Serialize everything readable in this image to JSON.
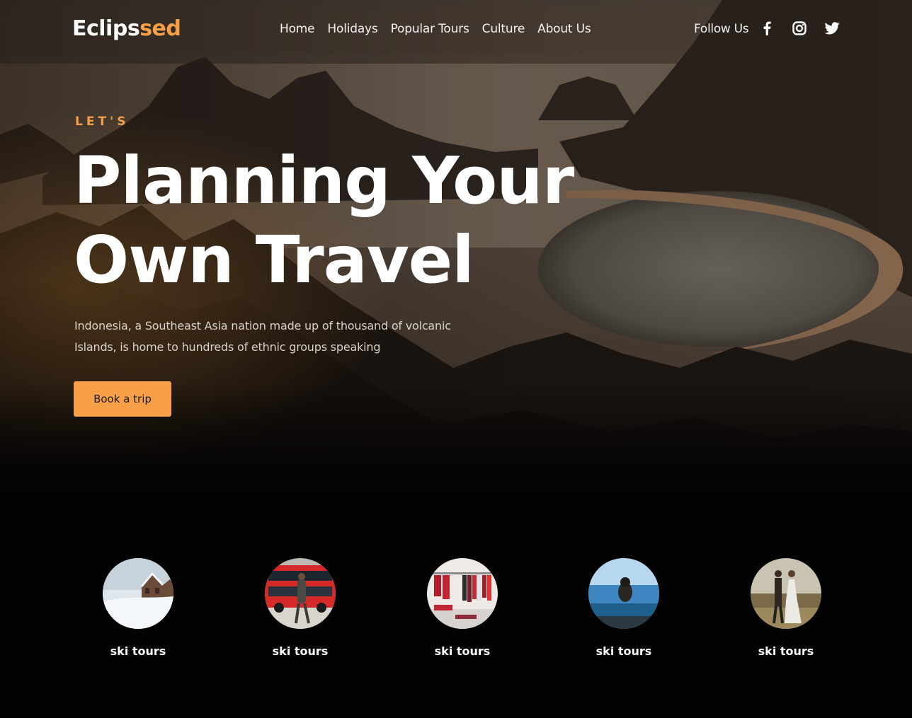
{
  "brand": {
    "part1": "Eclips",
    "part2": "sed"
  },
  "nav": [
    {
      "label": "Home"
    },
    {
      "label": "Holidays"
    },
    {
      "label": "Popular Tours"
    },
    {
      "label": "Culture"
    },
    {
      "label": "About Us"
    }
  ],
  "social": {
    "label": "Follow Us",
    "icons": [
      "facebook-icon",
      "instagram-icon",
      "twitter-icon"
    ]
  },
  "hero": {
    "eyebrow": "LET'S",
    "title_line1": "Planning Your",
    "title_line2": "Own Travel",
    "description_line1": "Indonesia, a Southeast Asia nation made up of thousand of volcanic",
    "description_line2": "Islands, is home to hundreds of ethnic groups speaking",
    "cta_label": "Book a trip"
  },
  "categories": [
    {
      "label": "ski tours",
      "image": "snowy-cabin"
    },
    {
      "label": "ski tours",
      "image": "red-bus-street"
    },
    {
      "label": "ski tours",
      "image": "clothing-store"
    },
    {
      "label": "ski tours",
      "image": "infinity-pool"
    },
    {
      "label": "ski tours",
      "image": "couple-walking"
    }
  ],
  "colors": {
    "accent": "#f7a048",
    "background": "#020202",
    "text": "#ffffff"
  }
}
